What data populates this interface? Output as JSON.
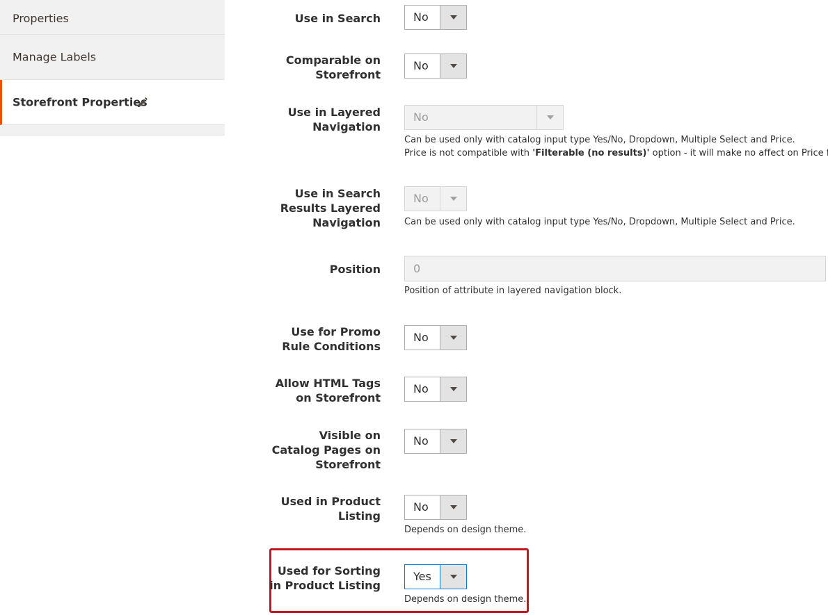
{
  "sidebar": {
    "items": [
      {
        "label": "Properties"
      },
      {
        "label": "Manage Labels"
      },
      {
        "label": "Storefront Properties",
        "icon": "pencil-icon"
      }
    ]
  },
  "fields": {
    "use_in_search": {
      "label": "Use in Search",
      "value": "No"
    },
    "comparable": {
      "label_1": "Comparable on",
      "label_2": "Storefront",
      "value": "No"
    },
    "layered_nav": {
      "label_1": "Use in Layered",
      "label_2": "Navigation",
      "value": "No",
      "note_1": "Can be used only with catalog input type Yes/No, Dropdown, Multiple Select and Price.",
      "note_2a": "Price is not compatible with ",
      "note_2b": "'Filterable (no results)'",
      "note_2c": " option - it will make no affect on Price filter."
    },
    "search_layered_nav": {
      "label_1": "Use in Search",
      "label_2": "Results Layered",
      "label_3": "Navigation",
      "value": "No",
      "note": "Can be used only with catalog input type Yes/No, Dropdown, Multiple Select and Price."
    },
    "position": {
      "label": "Position",
      "value": "0",
      "note": "Position of attribute in layered navigation block."
    },
    "promo_rules": {
      "label_1": "Use for Promo",
      "label_2": "Rule Conditions",
      "value": "No"
    },
    "html_tags": {
      "label_1": "Allow HTML Tags",
      "label_2": "on Storefront",
      "value": "No"
    },
    "visible_catalog": {
      "label_1": "Visible on",
      "label_2": "Catalog Pages on",
      "label_3": "Storefront",
      "value": "No"
    },
    "product_listing": {
      "label_1": "Used in Product",
      "label_2": "Listing",
      "value": "No",
      "note": "Depends on design theme."
    },
    "sorting": {
      "label_1": "Used for Sorting",
      "label_2": "in Product Listing",
      "value": "Yes",
      "note": "Depends on design theme."
    }
  },
  "colors": {
    "active_accent": "#eb5202",
    "highlight_border": "#c0181c",
    "focus_border": "#007bdb"
  }
}
